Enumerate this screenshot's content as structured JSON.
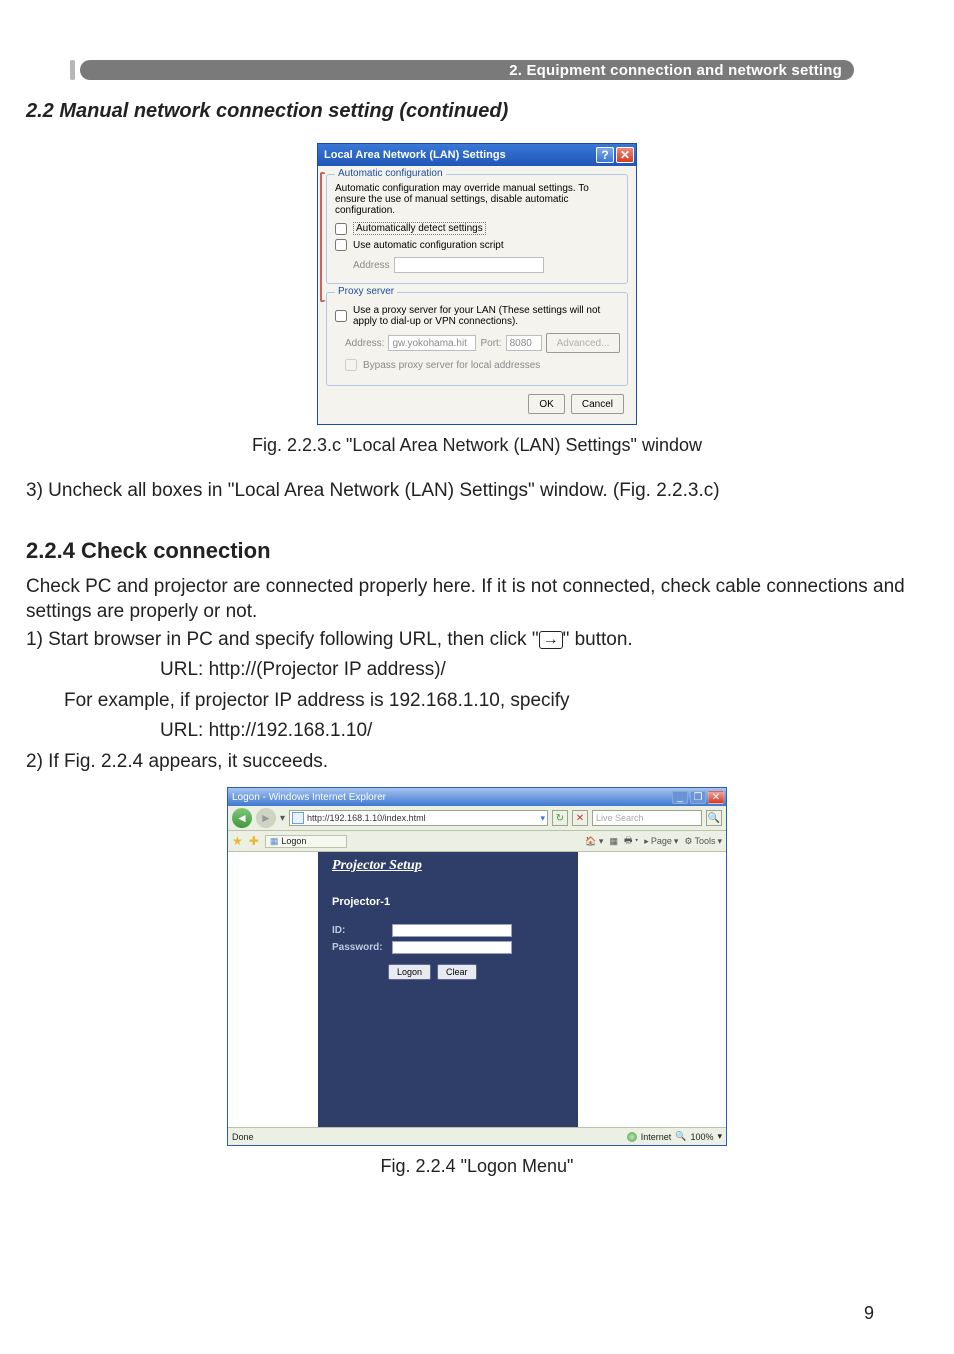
{
  "header": {
    "chapter_title": "2. Equipment connection and network setting"
  },
  "section_title": "2.2 Manual network connection setting (continued)",
  "lan_dialog": {
    "title": "Local Area Network (LAN) Settings",
    "auto_group_legend": "Automatic configuration",
    "auto_desc": "Automatic configuration may override manual settings. To ensure the use of manual settings, disable automatic configuration.",
    "auto_detect_label": "Automatically detect settings",
    "auto_script_label": "Use automatic configuration script",
    "address_label": "Address",
    "proxy_group_legend": "Proxy server",
    "proxy_use_label": "Use a proxy server for your LAN (These settings will not apply to dial-up or VPN connections).",
    "proxy_addr_label": "Address:",
    "proxy_addr_value": "gw.yokohama.hit",
    "proxy_port_label": "Port:",
    "proxy_port_value": "8080",
    "advanced_btn": "Advanced...",
    "bypass_label": "Bypass proxy server for local addresses",
    "ok_btn": "OK",
    "cancel_btn": "Cancel"
  },
  "fig1_caption": "Fig. 2.2.3.c \"Local Area Network (LAN) Settings\" window",
  "step3_text": "3) Uncheck all boxes in \"Local Area Network (LAN) Settings\" window. (Fig. 2.2.3.c)",
  "subhead": "2.2.4 Check connection",
  "check_p1": "Check PC and projector are connected properly here. If it is not connected, check cable connections and settings are properly or not.",
  "check_step1_a": "1) Start browser in PC and specify following URL, then click \"",
  "check_step1_b": "\" button.",
  "url_template_line": "URL: http://(Projector IP address)/",
  "example_line": "For example, if projector IP address is 192.168.1.10, specify",
  "url_example_line": "URL: http://192.168.1.10/",
  "check_step2": "2) If Fig. 2.2.4 appears, it succeeds.",
  "ie": {
    "window_title": "Logon - Windows Internet Explorer",
    "url": "http://192.168.1.10/index.html",
    "search_placeholder": "Live Search",
    "tab_label": "Logon",
    "tools": {
      "page": "Page",
      "tools": "Tools"
    },
    "panel_heading": "Projector Setup",
    "projector_name": "Projector-1",
    "id_label": "ID:",
    "pw_label": "Password:",
    "logon_btn": "Logon",
    "clear_btn": "Clear",
    "status_done": "Done",
    "status_zone": "Internet",
    "status_zoom": "100%"
  },
  "fig2_caption": "Fig. 2.2.4 \"Logon Menu\"",
  "page_number": "9"
}
